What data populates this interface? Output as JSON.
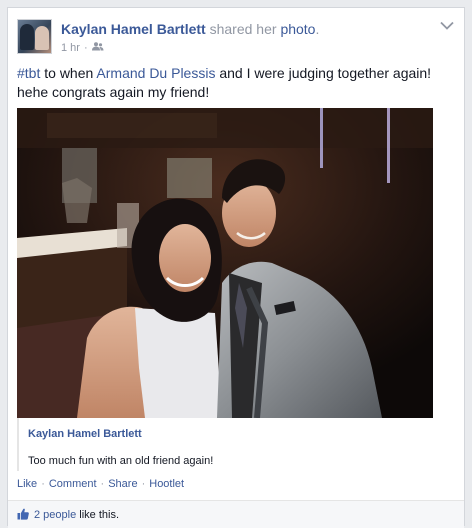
{
  "post": {
    "author": "Kaylan Hamel Bartlett",
    "verb": "shared her",
    "object_link": "photo",
    "period": ".",
    "timestamp": "1 hr",
    "audience_icon": "friends-icon"
  },
  "body": {
    "hashtag": "#tbt",
    "text_1": " to when ",
    "mention": "Armand Du Plessis",
    "text_2": " and I were judging together again! hehe congrats again my friend!"
  },
  "shared": {
    "author": "Kaylan Hamel Bartlett",
    "caption": "Too much fun with an old friend again!"
  },
  "actions": {
    "like": "Like",
    "comment": "Comment",
    "share": "Share",
    "hootlet": "Hootlet",
    "separator": "·"
  },
  "likes": {
    "count": "2 people",
    "suffix": " like this."
  },
  "colors": {
    "link": "#3b5998",
    "muted": "#9197a3",
    "text": "#141823"
  }
}
